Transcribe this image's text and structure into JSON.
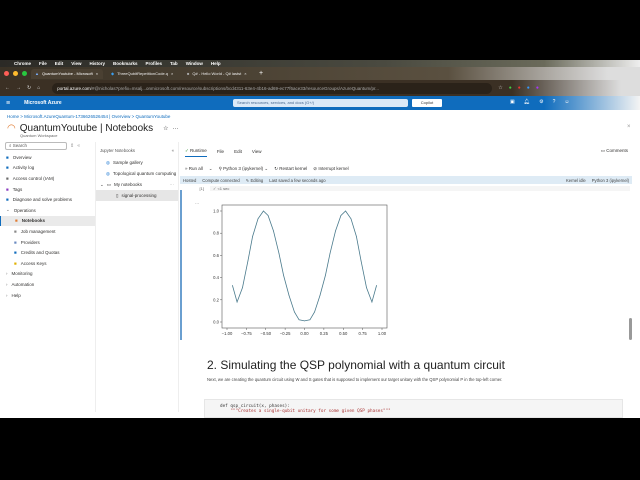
{
  "mac_menu": [
    "Chrome",
    "File",
    "Edit",
    "View",
    "History",
    "Bookmarks",
    "Profiles",
    "Tab",
    "Window",
    "Help"
  ],
  "browser": {
    "tabs": [
      {
        "label": "QuantumYoutube - Microsoft"
      },
      {
        "label": "ThreeQubitRepetitionCode.q"
      },
      {
        "label": "Q# - Hello World - Q# lastst"
      }
    ],
    "url_host": "portal.azure.com",
    "url_rest": "/#@nicholas?prefix=msalj...onmicrosoft.com/resource/subscriptions/bcd4311-63e4-4b16-ad69-ec77f6ace33/resourceGroups/AzureQuantum/pr..."
  },
  "azure": {
    "brand": "Microsoft Azure",
    "search_placeholder": "Search resources, services, and docs (G+/)",
    "copilot": "Copilot"
  },
  "breadcrumb": [
    "Home",
    "Microsoft.AzureQuantum-1736626526454 | Overview",
    "QuantumYoutube"
  ],
  "page": {
    "title": "QuantumYoutube | Notebooks",
    "subtitle": "Quantum Workspace"
  },
  "sidebar": {
    "search": "Search",
    "items": [
      {
        "label": "Overview",
        "icon": "overview-icon",
        "color": "#0f6cbd"
      },
      {
        "label": "Activity log",
        "icon": "activity-log-icon",
        "color": "#0f6cbd"
      },
      {
        "label": "Access control (IAM)",
        "icon": "iam-icon",
        "color": "#6a6a6a"
      },
      {
        "label": "Tags",
        "icon": "tag-icon",
        "color": "#8a3ac0"
      },
      {
        "label": "Diagnose and solve problems",
        "icon": "diagnose-icon",
        "color": "#0f6cbd"
      },
      {
        "label": "Operations",
        "icon": "chevron-down-icon",
        "group": true
      },
      {
        "label": "Notebooks",
        "icon": "notebook-icon",
        "color": "#e07a30",
        "sub": true,
        "selected": true
      },
      {
        "label": "Job management",
        "icon": "job-icon",
        "color": "#888",
        "sub": true
      },
      {
        "label": "Providers",
        "icon": "providers-icon",
        "color": "#6a8ac0",
        "sub": true
      },
      {
        "label": "Credits and Quotas",
        "icon": "credits-icon",
        "color": "#0f6cbd",
        "sub": true
      },
      {
        "label": "Access Keys",
        "icon": "key-icon",
        "color": "#e0b000",
        "sub": true
      },
      {
        "label": "Monitoring",
        "icon": "chevron-right-icon",
        "group": true
      },
      {
        "label": "Automation",
        "icon": "chevron-right-icon",
        "group": true
      },
      {
        "label": "Help",
        "icon": "chevron-right-icon",
        "group": true
      }
    ]
  },
  "notebooks": {
    "header": "Jupyter Notebooks",
    "items": [
      "Sample gallery",
      "Topological quantum computing",
      "My notebooks",
      "signal-processing"
    ]
  },
  "editor": {
    "menu": [
      "Runtime",
      "File",
      "Edit",
      "View"
    ],
    "comments": "Comments",
    "toolbar": {
      "run_all": "Run all",
      "kernel": "Python 3 (ipykernel)",
      "restart": "Restart kernel",
      "interrupt": "Interrupt kernel"
    },
    "status": {
      "hosted": "Hosted",
      "compute": "Compute connected",
      "editing": "Editing",
      "saved": "Last saved a few seconds ago",
      "kernel_state": "Kernel idle",
      "kernel": "Python 3 (ipykernel)"
    },
    "cell_count": "[1]",
    "cell_time": "<1 sec",
    "output_more": "...",
    "heading": "2. Simulating the QSP polynomial with a quantum circuit",
    "para": "Next, we are creating the quantum circuit using W and S gates that is supposed to implement our target unitary with the QSP polynomial P in the top-left corner.",
    "code": [
      "def qsp_circuit(x, phases):",
      "    \"\"\"Creates a single-qubit unitary for some given QSP phases\"\"\""
    ]
  },
  "chart_data": {
    "type": "line",
    "title": "",
    "xlabel": "",
    "ylabel": "",
    "xlim": [
      -1.0,
      1.0
    ],
    "ylim": [
      0.0,
      1.0
    ],
    "xticks": [
      "−1.00",
      "−0.75",
      "−0.50",
      "−0.25",
      "0.00",
      "0.25",
      "0.50",
      "0.75",
      "1.00"
    ],
    "yticks": [
      "0.0",
      "0.2",
      "0.4",
      "0.6",
      "0.8",
      "1.0"
    ],
    "x": [
      -0.93,
      -0.87,
      -0.8,
      -0.73,
      -0.67,
      -0.6,
      -0.53,
      -0.47,
      -0.4,
      -0.33,
      -0.27,
      -0.2,
      -0.13,
      -0.07,
      0,
      0.07,
      0.13,
      0.2,
      0.27,
      0.33,
      0.4,
      0.47,
      0.53,
      0.6,
      0.67,
      0.73,
      0.8,
      0.87,
      0.93
    ],
    "y": [
      0.33,
      0.18,
      0.31,
      0.55,
      0.77,
      0.93,
      1.0,
      0.96,
      0.82,
      0.62,
      0.42,
      0.24,
      0.09,
      0.02,
      0.01,
      0.02,
      0.09,
      0.24,
      0.42,
      0.62,
      0.82,
      0.96,
      1.0,
      0.93,
      0.77,
      0.55,
      0.31,
      0.18,
      0.33
    ],
    "color": "#4a7a8c"
  }
}
